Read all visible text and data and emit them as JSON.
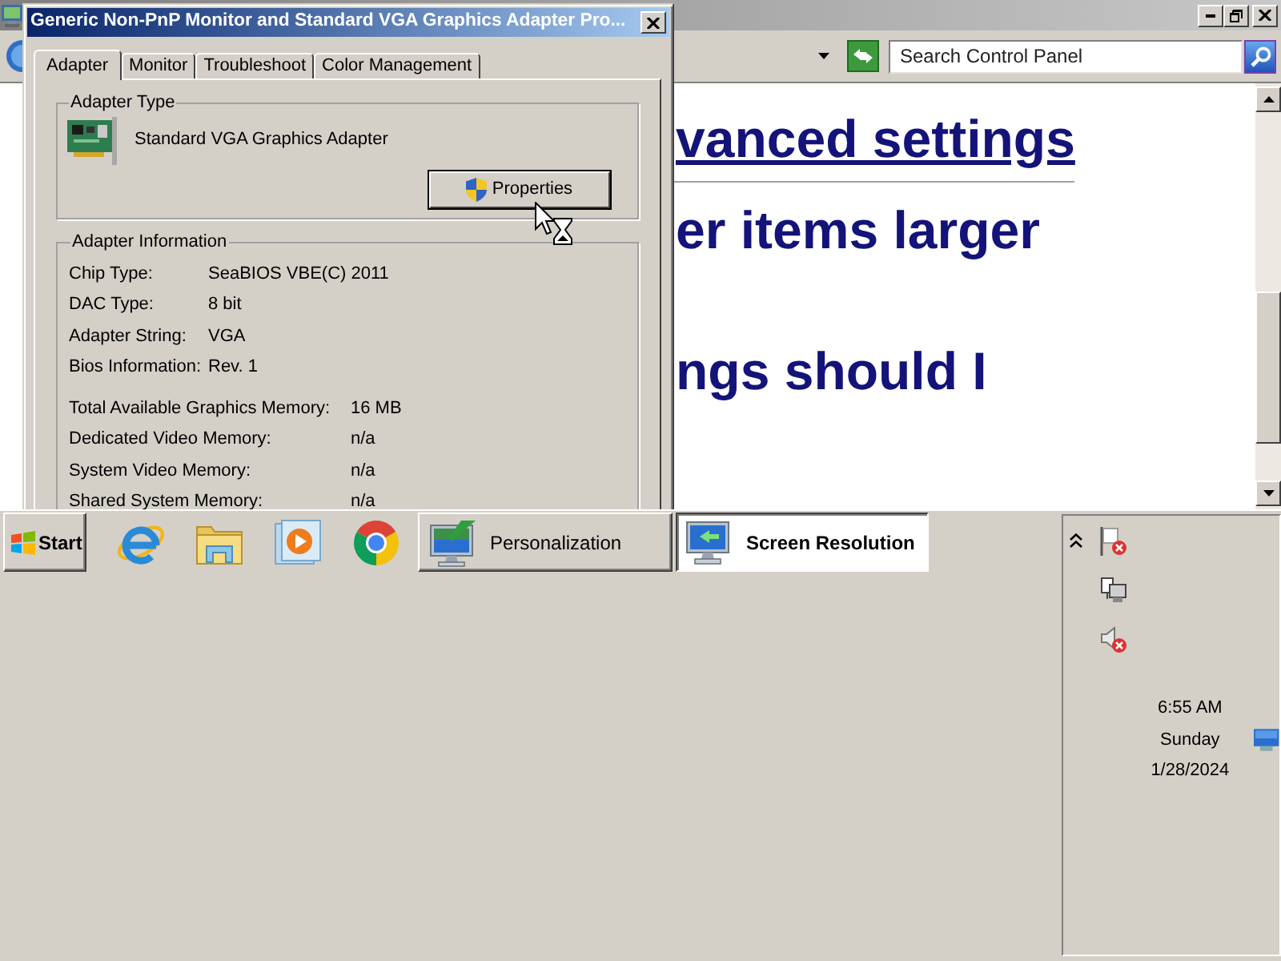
{
  "background_window": {
    "search": {
      "placeholder": "Search Control Panel"
    },
    "content": [
      {
        "kind": "link",
        "text": "vanced settings"
      },
      {
        "kind": "heading",
        "text": "er items larger"
      },
      {
        "kind": "heading",
        "text": "ngs should I"
      }
    ]
  },
  "dialog": {
    "title": "Generic Non-PnP Monitor and Standard VGA Graphics Adapter Pro...",
    "tabs": [
      {
        "label": "Adapter",
        "selected": true
      },
      {
        "label": "Monitor",
        "selected": false
      },
      {
        "label": "Troubleshoot",
        "selected": false
      },
      {
        "label": "Color Management",
        "selected": false
      }
    ],
    "adapter_type": {
      "legend": "Adapter Type",
      "adapter": "Standard VGA Graphics Adapter",
      "button": "Properties"
    },
    "adapter_information": {
      "legend": "Adapter Information",
      "details": [
        {
          "label": "Chip Type:",
          "value": "SeaBIOS VBE(C) 2011"
        },
        {
          "label": "DAC Type:",
          "value": "8 bit"
        },
        {
          "label": "Adapter String:",
          "value": "VGA"
        },
        {
          "label": "Bios Information:",
          "value": "Rev. 1"
        }
      ],
      "memory": [
        {
          "label": "Total Available Graphics Memory:",
          "value": "16 MB"
        },
        {
          "label": "Dedicated Video Memory:",
          "value": "n/a"
        },
        {
          "label": "System Video Memory:",
          "value": "n/a"
        },
        {
          "label": "Shared System Memory:",
          "value": "n/a"
        }
      ]
    }
  },
  "taskbar": {
    "start": "Start",
    "tasks": [
      {
        "label": "Personalization",
        "selected": false
      },
      {
        "label": "Screen Resolution",
        "selected": true
      }
    ],
    "clock": {
      "time": "6:55 AM",
      "day": "Sunday",
      "date": "1/28/2024"
    }
  }
}
